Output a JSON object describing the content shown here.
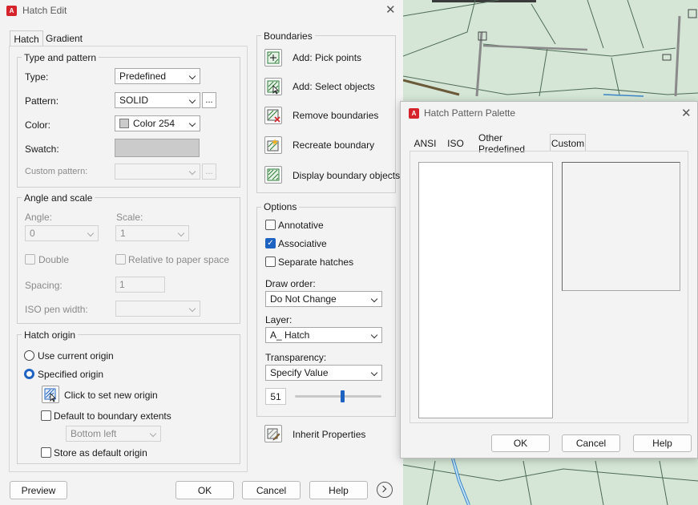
{
  "hatch_edit": {
    "title": "Hatch Edit",
    "tabs": [
      "Hatch",
      "Gradient"
    ],
    "type_pattern": {
      "legend": "Type and pattern",
      "type_label": "Type:",
      "type_value": "Predefined",
      "pattern_label": "Pattern:",
      "pattern_value": "SOLID",
      "ellipsis": "...",
      "color_label": "Color:",
      "color_value": "Color 254",
      "swatch_label": "Swatch:",
      "custom_label": "Custom pattern:"
    },
    "angle_scale": {
      "legend": "Angle and scale",
      "angle_label": "Angle:",
      "angle_value": "0",
      "scale_label": "Scale:",
      "scale_value": "1",
      "double_label": "Double",
      "relative_label": "Relative to paper space",
      "spacing_label": "Spacing:",
      "spacing_value": "1",
      "iso_label": "ISO pen width:"
    },
    "origin": {
      "legend": "Hatch origin",
      "use_current": "Use current origin",
      "specified": "Specified origin",
      "click_set": "Click to set new origin",
      "default_extents": "Default to boundary extents",
      "extents_value": "Bottom left",
      "store_default": "Store as default origin"
    },
    "boundaries": {
      "legend": "Boundaries",
      "add_pick": "Add: Pick points",
      "add_select": "Add: Select objects",
      "remove": "Remove boundaries",
      "recreate": "Recreate boundary",
      "display": "Display boundary objects"
    },
    "options": {
      "legend": "Options",
      "annotative": "Annotative",
      "associative": "Associative",
      "separate": "Separate hatches",
      "draw_order_label": "Draw order:",
      "draw_order_value": "Do Not Change",
      "layer_label": "Layer:",
      "layer_value": "A_ Hatch",
      "transparency_label": "Transparency:",
      "transparency_value": "Specify Value",
      "transparency_amount": "51",
      "slider_fraction": 0.55
    },
    "inherit": "Inherit Properties",
    "buttons": {
      "preview": "Preview",
      "ok": "OK",
      "cancel": "Cancel",
      "help": "Help"
    }
  },
  "palette": {
    "title": "Hatch Pattern Palette",
    "tabs": [
      "ANSI",
      "ISO",
      "Other Predefined",
      "Custom"
    ],
    "buttons": {
      "ok": "OK",
      "cancel": "Cancel",
      "help": "Help"
    }
  },
  "icons": {
    "app": "autocad-app-icon",
    "close": "close-icon",
    "more": "chevron-right-circle-icon"
  },
  "colors": {
    "accent": "#1f63c2",
    "map_fill": "#d5e6d6",
    "map_line": "#4e6b57",
    "app_red": "#d6242c"
  }
}
